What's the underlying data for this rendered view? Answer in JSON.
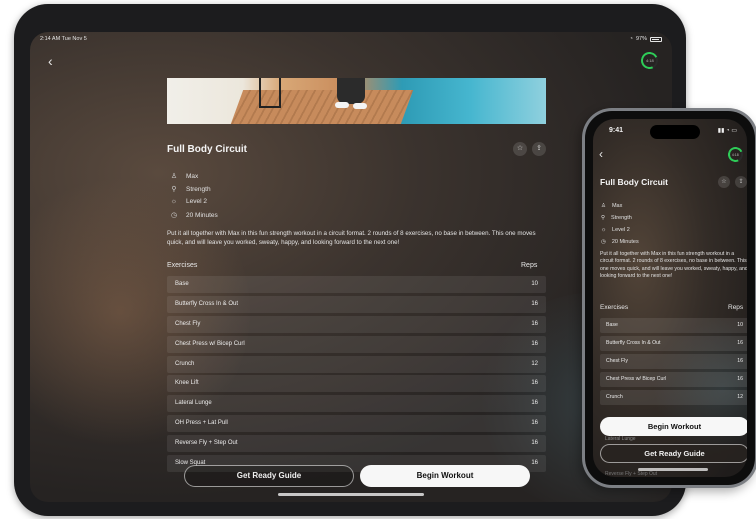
{
  "accent": {
    "ring": "#2ecc58",
    "primary_button_bg": "#f7f7f7"
  },
  "ipad": {
    "status": {
      "time": "2:14 AM  Tue Nov 5",
      "battery": "97%"
    },
    "ring_label": "4:18",
    "title": "Full Body Circuit",
    "actions": {
      "favorite_icon": "star-icon",
      "share_icon": "share-icon"
    },
    "meta": [
      {
        "icon": "person-icon",
        "text": "Max"
      },
      {
        "icon": "dumbbell-icon",
        "text": "Strength"
      },
      {
        "icon": "level-icon",
        "text": "Level 2"
      },
      {
        "icon": "clock-icon",
        "text": "20 Minutes"
      }
    ],
    "description": "Put it all together with Max in this fun strength workout in a circuit format.  2 rounds of 8 exercises, no base in between.  This one moves quick, and will leave you worked, sweaty, happy, and looking forward to the next one!",
    "headers": {
      "exercises": "Exercises",
      "reps": "Reps"
    },
    "exercises": [
      {
        "name": "Base",
        "reps": "10"
      },
      {
        "name": "Butterfly Cross In & Out",
        "reps": "16"
      },
      {
        "name": "Chest Fly",
        "reps": "16"
      },
      {
        "name": "Chest Press w/ Bicep Curl",
        "reps": "16"
      },
      {
        "name": "Crunch",
        "reps": "12"
      },
      {
        "name": "Knee Lift",
        "reps": "16"
      },
      {
        "name": "Lateral Lunge",
        "reps": "16"
      },
      {
        "name": "OH Press + Lat Pull",
        "reps": "16"
      },
      {
        "name": "Reverse Fly + Step Out",
        "reps": "16"
      },
      {
        "name": "Slow Squat",
        "reps": "16"
      }
    ],
    "buttons": {
      "guide": "Get Ready Guide",
      "begin": "Begin Workout"
    }
  },
  "iphone": {
    "status": {
      "time": "9:41"
    },
    "ring_label": "4:18",
    "title": "Full Body Circuit",
    "meta": [
      {
        "icon": "person-icon",
        "text": "Max"
      },
      {
        "icon": "dumbbell-icon",
        "text": "Strength"
      },
      {
        "icon": "level-icon",
        "text": "Level 2"
      },
      {
        "icon": "clock-icon",
        "text": "20 Minutes"
      }
    ],
    "description": "Put it all together with Max in this fun strength workout in a circuit format.  2 rounds of 8 exercises, no base in between.  This one moves quick, and will leave you worked, sweaty, happy, and looking forward to the next one!",
    "headers": {
      "exercises": "Exercises",
      "reps": "Reps"
    },
    "exercises": [
      {
        "name": "Base",
        "reps": "10"
      },
      {
        "name": "Butterfly Cross In & Out",
        "reps": "16"
      },
      {
        "name": "Chest Fly",
        "reps": "16"
      },
      {
        "name": "Chest Press w/ Bicep Curl",
        "reps": "16"
      },
      {
        "name": "Crunch",
        "reps": "12"
      }
    ],
    "behind_begin": {
      "name": "Lateral Lunge",
      "reps": "16"
    },
    "behind_guide": {
      "name": "Reverse Fly + Step Out",
      "reps": "16"
    },
    "buttons": {
      "begin": "Begin Workout",
      "guide": "Get Ready Guide"
    }
  }
}
